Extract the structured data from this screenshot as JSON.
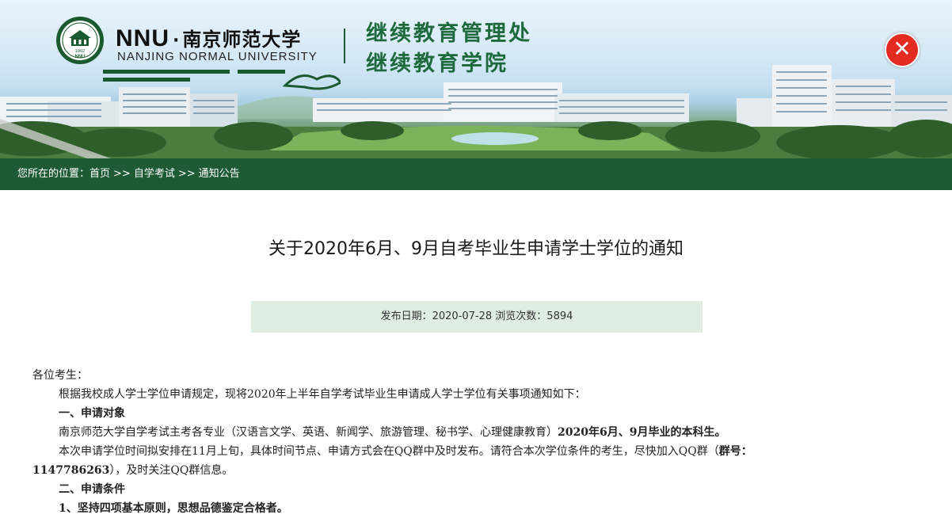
{
  "header": {
    "nnu": "NNU",
    "dot": "·",
    "university_cn": "南京师范大学",
    "university_en": "NANJING NORMAL UNIVERSITY",
    "seal_text": "南京师范大学",
    "seal_year": "1902",
    "seal_short": "NNU",
    "dept_line1": "继续教育管理处",
    "dept_line2": "继续教育学院",
    "close_glyph": "✕"
  },
  "breadcrumb": {
    "prefix": "您所在的位置：",
    "items": [
      "首页",
      "自学考试",
      "通知公告"
    ],
    "separator": ">>"
  },
  "article": {
    "title": "关于2020年6月、9月自考毕业生申请学士学位的通知",
    "meta": "发布日期：2020-07-28  浏览次数：5894",
    "greeting": "各位考生：",
    "intro": "根据我校成人学士学位申请规定，现将2020年上半年自学考试毕业生申请成人学士学位有关事项通知如下：",
    "section1_title": "一、申请对象",
    "section1_text": "南京师范大学自学考试主考各专业（汉语言文学、英语、新闻学、旅游管理、秘书学、心理健康教育）",
    "section1_bold": "2020年6月、9月毕业的本科生。",
    "para2_text": "本次申请学位时间拟安排在11月上旬，具体时间节点、申请方式会在QQ群中及时发布。请符合本次学位条件的考生，尽快加入QQ群（",
    "para2_bold": "群号：",
    "para2_bold_number": "1147786263",
    "para2_tail": "），及时关注QQ群信息。",
    "section2_title": "二、申请条件",
    "condition1": "1、坚持四项基本原则，思想品德鉴定合格者。"
  }
}
